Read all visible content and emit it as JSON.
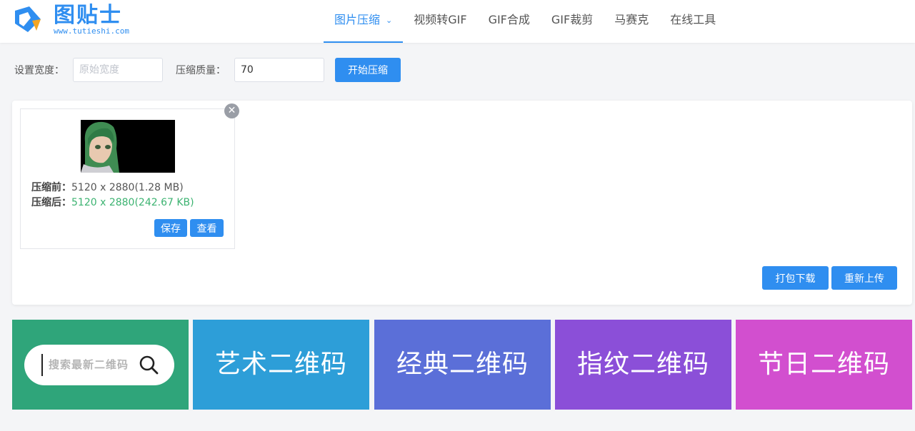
{
  "brand": {
    "name": "图贴士",
    "url": "www.tutieshi.com",
    "color": "#2f8ef0"
  },
  "nav": {
    "items": [
      {
        "label": "图片压缩",
        "active": true,
        "icon": "chevron-down-icon"
      },
      {
        "label": "视频转GIF"
      },
      {
        "label": "GIF合成"
      },
      {
        "label": "GIF裁剪"
      },
      {
        "label": "马赛克"
      },
      {
        "label": "在线工具"
      }
    ]
  },
  "settings": {
    "width_label": "设置宽度：",
    "width_placeholder": "原始宽度",
    "width_value": "",
    "quality_label": "压缩质量：",
    "quality_value": "70",
    "start_button": "开始压缩"
  },
  "result": {
    "before_label": "压缩前：",
    "before_value": "5120 x 2880(1.28 MB)",
    "after_label": "压缩后：",
    "after_value": "5120 x 2880(242.67 KB)",
    "after_color": "#3cb371",
    "save_button": "保存",
    "view_button": "查看",
    "close_icon": "close-icon"
  },
  "panel_actions": {
    "pack_download": "打包下载",
    "reupload": "重新上传"
  },
  "tiles": {
    "search_placeholder": "搜索最新二维码",
    "items": [
      {
        "label": "艺术二维码",
        "color": "#2d9ed8"
      },
      {
        "label": "经典二维码",
        "color": "#5b6fd8"
      },
      {
        "label": "指纹二维码",
        "color": "#8b4fd8"
      },
      {
        "label": "节日二维码",
        "color": "#d24fcf"
      }
    ],
    "search_tile_color": "#2fa57a"
  }
}
